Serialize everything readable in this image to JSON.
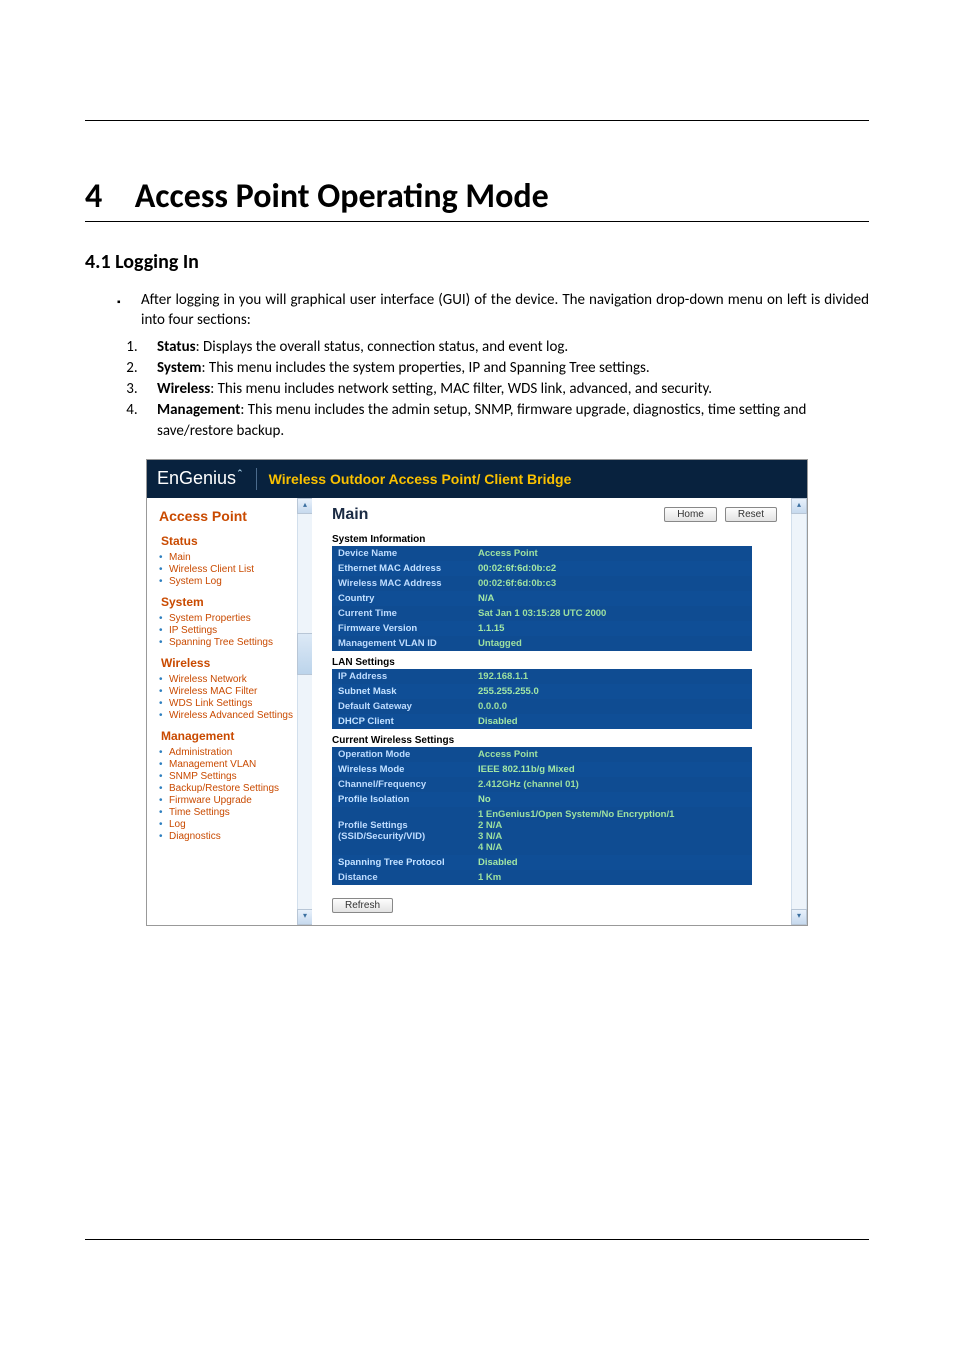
{
  "heading": {
    "number": "4",
    "title": "Access Point Operating Mode"
  },
  "section": {
    "number": "4.1",
    "title": "Logging In"
  },
  "intro": "After logging in you will graphical user interface (GUI) of the device. The navigation drop-down menu on left is divided into four sections:",
  "list": [
    {
      "term": "Status",
      "desc": ": Displays the overall status, connection status, and event log."
    },
    {
      "term": "System",
      "desc": ": This menu includes the system properties, IP and Spanning Tree settings."
    },
    {
      "term": "Wireless",
      "desc": ": This menu includes network setting, MAC filter, WDS link, advanced, and security."
    },
    {
      "term": "Management",
      "desc": ": This menu includes the admin setup, SNMP, firmware upgrade, diagnostics, time setting and save/restore backup."
    }
  ],
  "ui": {
    "logo": "EnGenius",
    "bannerTitle": "Wireless Outdoor Access Point/ Client Bridge",
    "mode": "Access Point",
    "sidebar": [
      {
        "head": "Status",
        "items": [
          "Main",
          "Wireless Client List",
          "System Log"
        ]
      },
      {
        "head": "System",
        "items": [
          "System Properties",
          "IP Settings",
          "Spanning Tree Settings"
        ]
      },
      {
        "head": "Wireless",
        "items": [
          "Wireless Network",
          "Wireless MAC Filter",
          "WDS Link Settings",
          "Wireless Advanced Settings"
        ]
      },
      {
        "head": "Management",
        "items": [
          "Administration",
          "Management VLAN",
          "SNMP Settings",
          "Backup/Restore Settings",
          "Firmware Upgrade",
          "Time Settings",
          "Log",
          "Diagnostics"
        ]
      }
    ],
    "mainTitle": "Main",
    "buttons": {
      "home": "Home",
      "reset": "Reset",
      "refresh": "Refresh"
    },
    "tables": [
      {
        "title": "System Information",
        "rows": [
          [
            "Device Name",
            "Access Point"
          ],
          [
            "Ethernet MAC Address",
            "00:02:6f:6d:0b:c2"
          ],
          [
            "Wireless MAC Address",
            "00:02:6f:6d:0b:c3"
          ],
          [
            "Country",
            "N/A"
          ],
          [
            "Current Time",
            "Sat Jan 1 03:15:28 UTC 2000"
          ],
          [
            "Firmware Version",
            "1.1.15"
          ],
          [
            "Management VLAN ID",
            "Untagged"
          ]
        ]
      },
      {
        "title": "LAN Settings",
        "rows": [
          [
            "IP Address",
            "192.168.1.1"
          ],
          [
            "Subnet Mask",
            "255.255.255.0"
          ],
          [
            "Default Gateway",
            "0.0.0.0"
          ],
          [
            "DHCP Client",
            "Disabled"
          ]
        ]
      },
      {
        "title": "Current Wireless Settings",
        "rows": [
          [
            "Operation Mode",
            "Access Point"
          ],
          [
            "Wireless Mode",
            "IEEE 802.11b/g Mixed"
          ],
          [
            "Channel/Frequency",
            "2.412GHz (channel 01)"
          ],
          [
            "Profile Isolation",
            "No"
          ],
          [
            "Profile Settings (SSID/Security/VID)",
            "1 EnGenius1/Open System/No Encryption/1\n2 N/A\n3 N/A\n4 N/A"
          ],
          [
            "Spanning Tree Protocol",
            "Disabled"
          ],
          [
            "Distance",
            "1 Km"
          ]
        ]
      }
    ]
  }
}
